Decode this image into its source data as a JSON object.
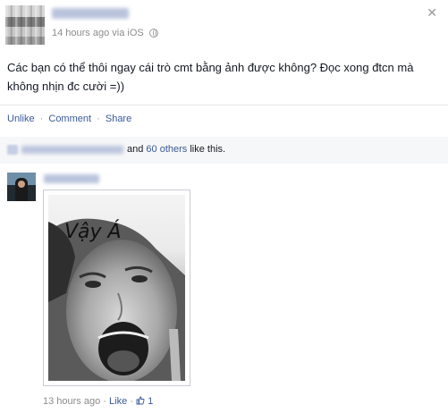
{
  "post": {
    "timestamp": "14 hours ago",
    "via": "via iOS",
    "close_glyph": "✕",
    "status_text": "Các bạn có thể thôi ngay cái trò cmt bằng ảnh được không? Đọc xong đtcn mà không nhịn đc cười =))"
  },
  "actions": {
    "unlike": "Unlike",
    "comment": "Comment",
    "share": "Share",
    "separator": "·"
  },
  "likes": {
    "and": "and",
    "others": "60 others",
    "like_this": "like this."
  },
  "comment": {
    "photo_caption": "Vậy Á",
    "timestamp": "13 hours ago",
    "separator": "·",
    "like": "Like",
    "like_count": "1"
  },
  "colors": {
    "link": "#3b5998",
    "meta": "#8c8c8c",
    "likes_bar_bg": "#f6f7f8"
  },
  "icons": {
    "globe": "globe-icon",
    "close": "close-icon",
    "thumb": "thumbs-up-icon"
  }
}
